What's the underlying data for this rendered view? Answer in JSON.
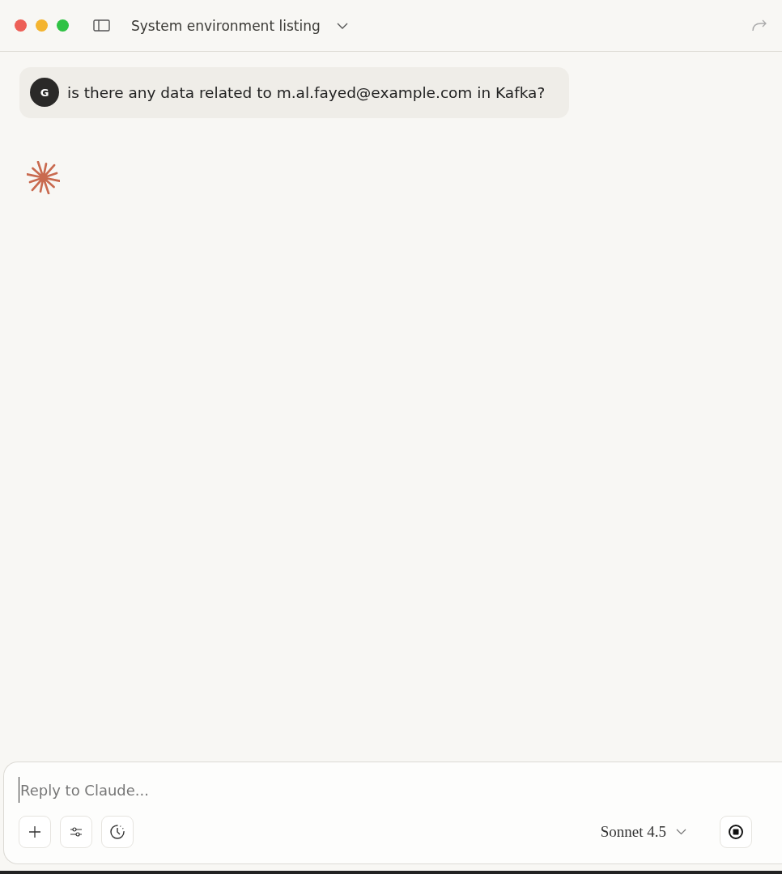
{
  "window": {
    "title": "System environment listing"
  },
  "messages": [
    {
      "avatar": "G",
      "text": "is there any data related to m.al.fayed@example.com in Kafka?"
    }
  ],
  "assistant": {
    "thinking": true
  },
  "composer": {
    "placeholder": "Reply to Claude...",
    "model": "Sonnet 4.5"
  }
}
